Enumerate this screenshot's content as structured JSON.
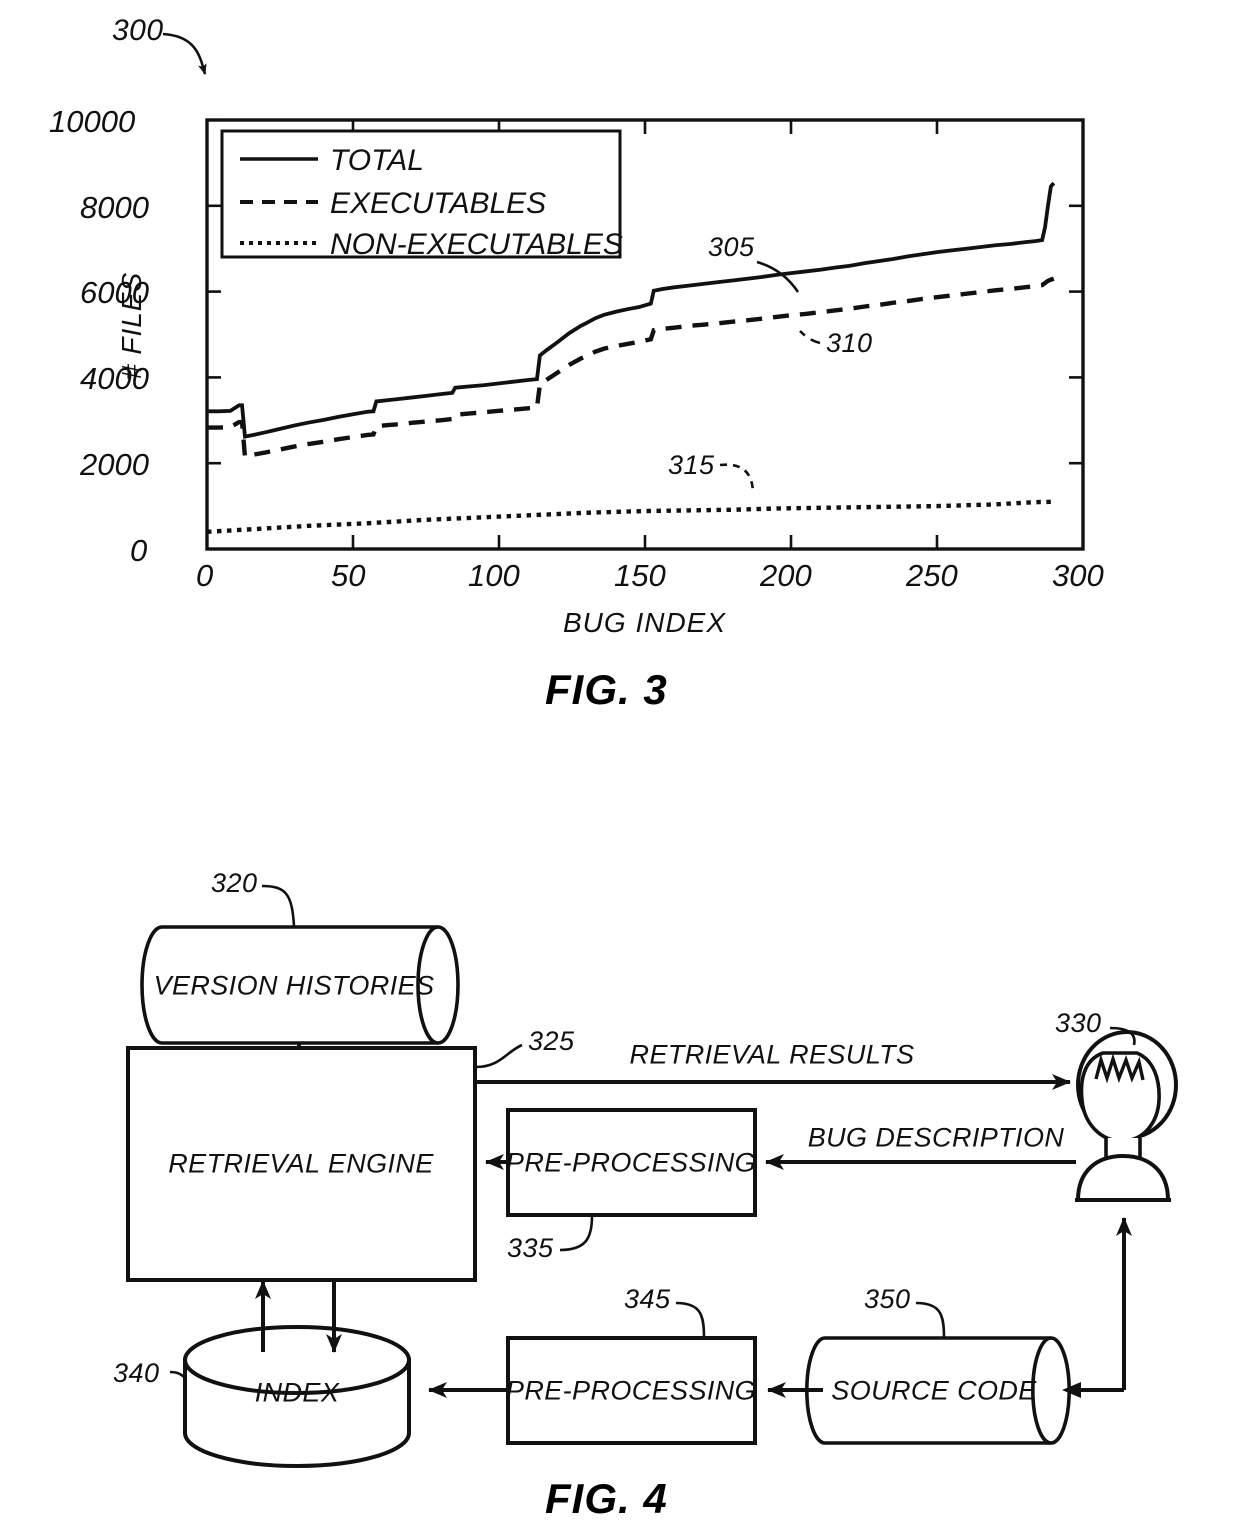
{
  "figure3": {
    "ref_number": "300",
    "caption": "FIG. 3",
    "axis": {
      "ylabel": "# FILES",
      "xlabel": "BUG INDEX",
      "yticks": [
        "0",
        "2000",
        "4000",
        "6000",
        "8000",
        "10000"
      ],
      "xticks": [
        "0",
        "50",
        "100",
        "150",
        "200",
        "250",
        "300"
      ]
    },
    "legend": {
      "items": [
        {
          "label": "TOTAL",
          "style": "solid"
        },
        {
          "label": "EXECUTABLES",
          "style": "dashed"
        },
        {
          "label": "NON-EXECUTABLES",
          "style": "dotted"
        }
      ]
    },
    "callouts": [
      {
        "id": "305",
        "series": "TOTAL"
      },
      {
        "id": "310",
        "series": "EXECUTABLES"
      },
      {
        "id": "315",
        "series": "NON-EXECUTABLES"
      }
    ]
  },
  "chart_data": {
    "type": "line",
    "title": "",
    "xlabel": "BUG INDEX",
    "ylabel": "# FILES",
    "xlim": [
      0,
      300
    ],
    "ylim": [
      0,
      10000
    ],
    "xticks": [
      0,
      50,
      100,
      150,
      200,
      250,
      300
    ],
    "yticks": [
      0,
      2000,
      4000,
      6000,
      8000,
      10000
    ],
    "grid": false,
    "legend_position": "upper-left-inside",
    "annotations": [
      {
        "text": "305",
        "points_to": "TOTAL",
        "x": 175,
        "y": 6300
      },
      {
        "text": "310",
        "points_to": "EXECUTABLES",
        "x": 205,
        "y": 5050
      },
      {
        "text": "315",
        "points_to": "NON-EXECUTABLES",
        "x": 160,
        "y": 1700
      }
    ],
    "series": [
      {
        "name": "TOTAL",
        "style": "solid",
        "x": [
          0,
          4,
          8,
          11,
          12,
          13,
          16,
          20,
          25,
          30,
          35,
          40,
          45,
          50,
          55,
          57,
          58,
          62,
          66,
          70,
          75,
          80,
          84,
          85,
          90,
          95,
          100,
          105,
          110,
          113,
          114,
          116,
          120,
          124,
          128,
          130,
          133,
          136,
          140,
          144,
          148,
          150,
          152,
          153,
          156,
          160,
          165,
          170,
          175,
          180,
          185,
          190,
          195,
          200,
          205,
          210,
          215,
          220,
          225,
          230,
          235,
          240,
          245,
          250,
          255,
          260,
          265,
          270,
          275,
          280,
          284,
          286,
          287,
          288,
          289,
          290
        ],
        "y": [
          3210,
          3210,
          3220,
          3350,
          3350,
          2620,
          2660,
          2720,
          2800,
          2880,
          2950,
          3010,
          3080,
          3140,
          3200,
          3210,
          3440,
          3470,
          3500,
          3530,
          3570,
          3610,
          3640,
          3760,
          3790,
          3820,
          3860,
          3900,
          3940,
          3960,
          4510,
          4620,
          4820,
          5030,
          5200,
          5270,
          5380,
          5460,
          5530,
          5590,
          5640,
          5680,
          5720,
          6020,
          6060,
          6100,
          6140,
          6180,
          6220,
          6260,
          6300,
          6340,
          6390,
          6430,
          6470,
          6510,
          6560,
          6600,
          6660,
          6710,
          6760,
          6820,
          6870,
          6920,
          6960,
          7000,
          7040,
          7080,
          7110,
          7150,
          7180,
          7200,
          7500,
          8000,
          8450,
          8530
        ]
      },
      {
        "name": "EXECUTABLES",
        "style": "dashed",
        "x": [
          0,
          4,
          8,
          11,
          12,
          13,
          16,
          20,
          25,
          30,
          35,
          40,
          45,
          50,
          55,
          57,
          58,
          62,
          66,
          70,
          75,
          80,
          84,
          85,
          90,
          95,
          100,
          105,
          110,
          113,
          114,
          116,
          120,
          124,
          128,
          130,
          133,
          136,
          140,
          144,
          148,
          150,
          152,
          153,
          156,
          160,
          165,
          170,
          175,
          180,
          185,
          190,
          195,
          200,
          205,
          210,
          215,
          220,
          225,
          230,
          235,
          240,
          245,
          250,
          255,
          260,
          265,
          270,
          275,
          280,
          284,
          286,
          287,
          288,
          289,
          290
        ],
        "y": [
          2830,
          2830,
          2840,
          2960,
          2960,
          2150,
          2200,
          2250,
          2320,
          2390,
          2450,
          2500,
          2560,
          2610,
          2660,
          2670,
          2860,
          2890,
          2910,
          2940,
          2970,
          3000,
          3030,
          3130,
          3160,
          3190,
          3220,
          3250,
          3280,
          3300,
          3830,
          3930,
          4110,
          4290,
          4440,
          4500,
          4600,
          4670,
          4730,
          4780,
          4830,
          4860,
          4890,
          5100,
          5130,
          5160,
          5200,
          5230,
          5260,
          5300,
          5330,
          5370,
          5410,
          5450,
          5480,
          5520,
          5560,
          5600,
          5650,
          5690,
          5740,
          5780,
          5830,
          5870,
          5910,
          5950,
          5990,
          6030,
          6060,
          6100,
          6130,
          6150,
          6200,
          6250,
          6280,
          6300
        ]
      },
      {
        "name": "NON-EXECUTABLES",
        "style": "dotted",
        "x": [
          0,
          5,
          10,
          15,
          20,
          25,
          30,
          35,
          40,
          45,
          50,
          55,
          60,
          65,
          70,
          75,
          80,
          85,
          90,
          95,
          100,
          105,
          110,
          115,
          120,
          125,
          130,
          135,
          140,
          145,
          150,
          155,
          160,
          165,
          170,
          175,
          180,
          185,
          190,
          195,
          200,
          205,
          210,
          215,
          220,
          225,
          230,
          235,
          240,
          245,
          250,
          255,
          260,
          265,
          270,
          275,
          280,
          285,
          290
        ],
        "y": [
          400,
          420,
          440,
          460,
          480,
          500,
          520,
          540,
          555,
          570,
          585,
          600,
          620,
          640,
          660,
          680,
          695,
          710,
          725,
          740,
          755,
          770,
          785,
          800,
          815,
          830,
          845,
          855,
          865,
          875,
          885,
          890,
          895,
          900,
          905,
          910,
          915,
          925,
          935,
          945,
          950,
          955,
          960,
          965,
          970,
          975,
          980,
          985,
          990,
          995,
          1000,
          1010,
          1020,
          1030,
          1040,
          1060,
          1080,
          1095,
          1100
        ]
      }
    ]
  },
  "figure4": {
    "caption": "FIG. 4",
    "nodes": [
      {
        "id": "320",
        "label": "VERSION HISTORIES",
        "shape": "cylinder-horizontal"
      },
      {
        "id": "325",
        "label": "RETRIEVAL ENGINE",
        "shape": "rectangle"
      },
      {
        "id": "330",
        "label": "",
        "shape": "person"
      },
      {
        "id": "335",
        "label": "PRE-PROCESSING",
        "shape": "rectangle"
      },
      {
        "id": "340",
        "label": "INDEX",
        "shape": "cylinder-vertical"
      },
      {
        "id": "345",
        "label": "PRE-PROCESSING",
        "shape": "rectangle"
      },
      {
        "id": "350",
        "label": "SOURCE CODE",
        "shape": "cylinder-horizontal"
      }
    ],
    "edges": [
      {
        "label": "RETRIEVAL RESULTS",
        "from": "325",
        "to": "330"
      },
      {
        "label": "BUG DESCRIPTION",
        "from": "330",
        "to": "335"
      }
    ]
  }
}
